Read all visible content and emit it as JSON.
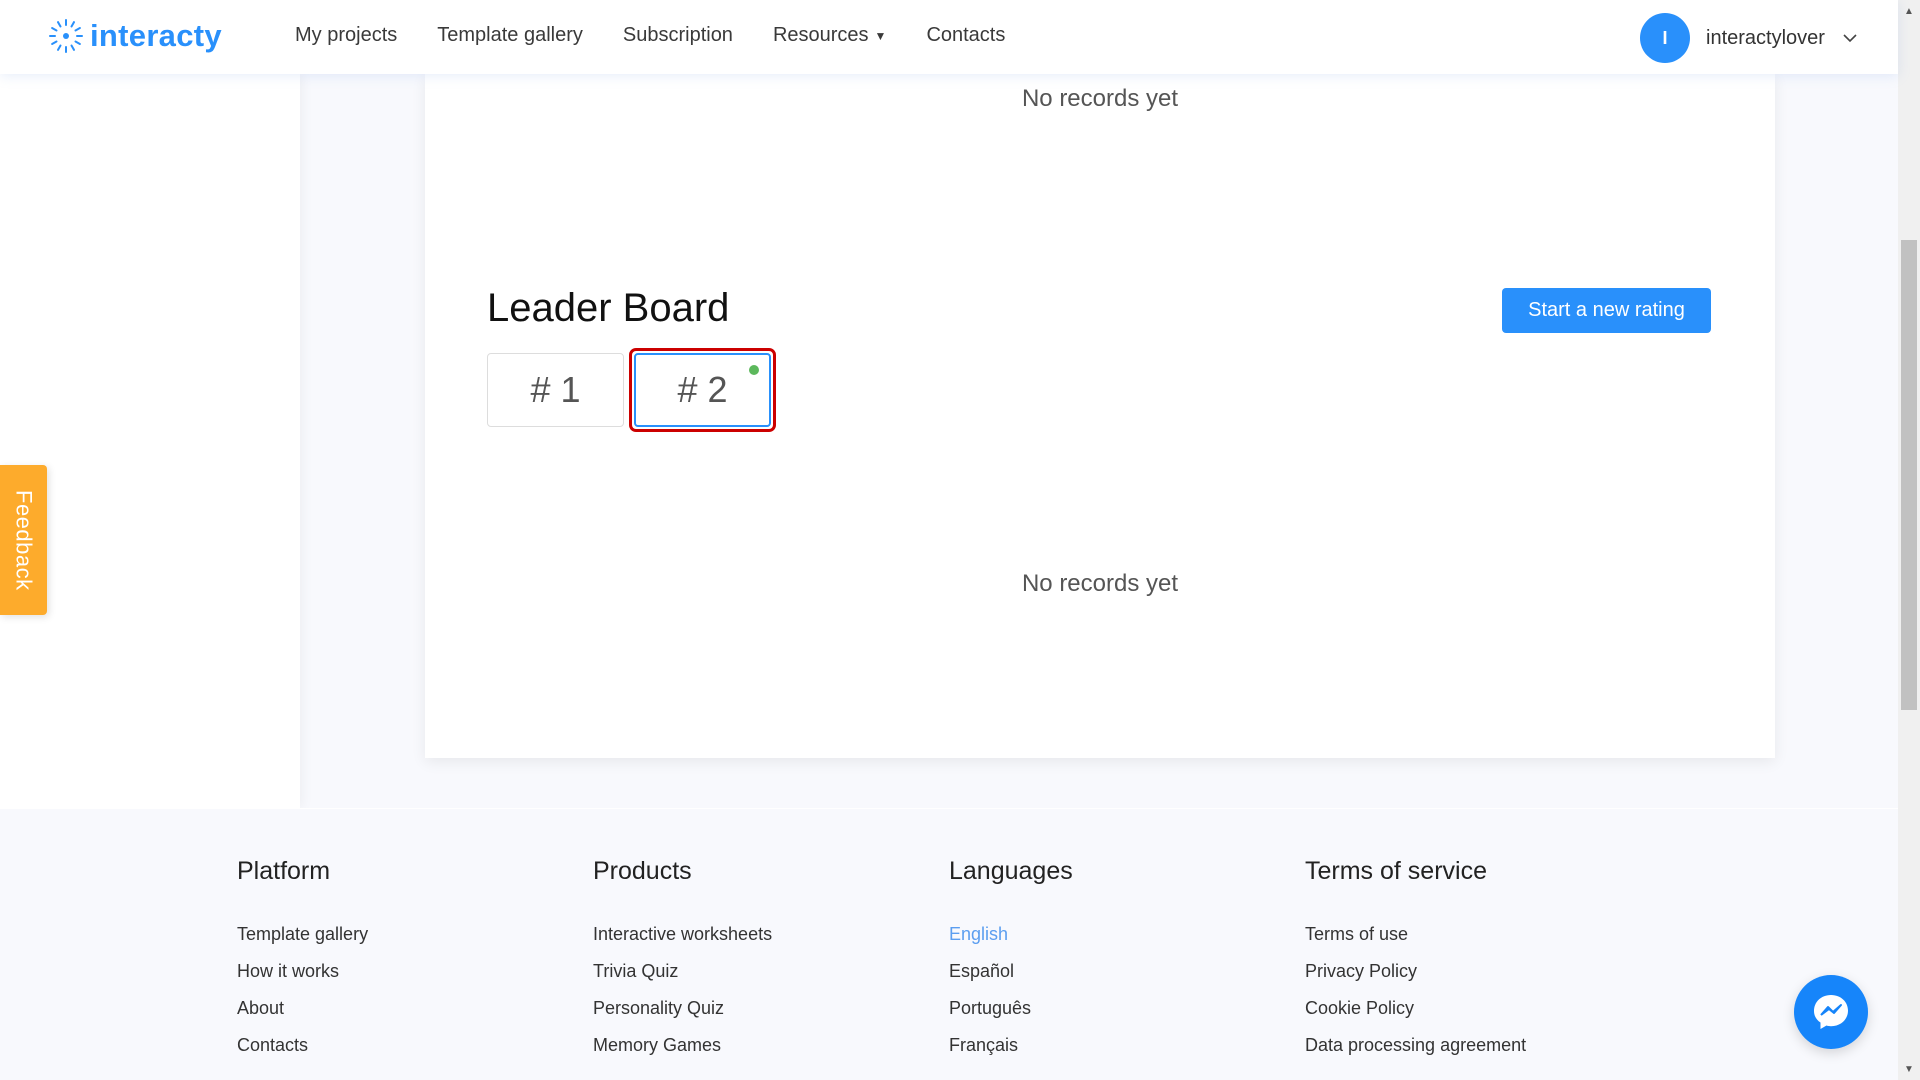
{
  "header": {
    "logo_text": "interacty",
    "nav": [
      {
        "label": "My projects"
      },
      {
        "label": "Template gallery"
      },
      {
        "label": "Subscription"
      },
      {
        "label": "Resources",
        "has_dropdown": true
      },
      {
        "label": "Contacts"
      }
    ],
    "user": {
      "avatar_initial": "I",
      "name": "interactylover"
    }
  },
  "main": {
    "top_empty_text": "No records yet",
    "leaderboard": {
      "title": "Leader Board",
      "start_button": "Start a new rating",
      "tabs": [
        {
          "label": "# 1",
          "active": false
        },
        {
          "label": "# 2",
          "active": true,
          "status_dot": "live"
        }
      ],
      "empty_text": "No records yet"
    }
  },
  "feedback": {
    "label": "Feedback"
  },
  "footer": {
    "columns": [
      {
        "title": "Platform",
        "links": [
          "Template gallery",
          "How it works",
          "About",
          "Contacts"
        ]
      },
      {
        "title": "Products",
        "links": [
          "Interactive worksheets",
          "Trivia Quiz",
          "Personality Quiz",
          "Memory Games"
        ]
      },
      {
        "title": "Languages",
        "links": [
          "English",
          "Español",
          "Português",
          "Français"
        ],
        "active": "English"
      },
      {
        "title": "Terms of service",
        "links": [
          "Terms of use",
          "Privacy Policy",
          "Cookie Policy",
          "Data processing agreement"
        ]
      }
    ]
  },
  "colors": {
    "brand": "#2990fb",
    "feedback": "#fdab2c",
    "status_dot": "#5cb85c",
    "active_language": "#5b9ef0",
    "highlight": "#cc0000"
  },
  "icons": {
    "logo": "interacty-logo-icon",
    "resources_caret": "caret-down-icon",
    "user_chevron": "chevron-down-icon",
    "messenger": "messenger-icon"
  }
}
